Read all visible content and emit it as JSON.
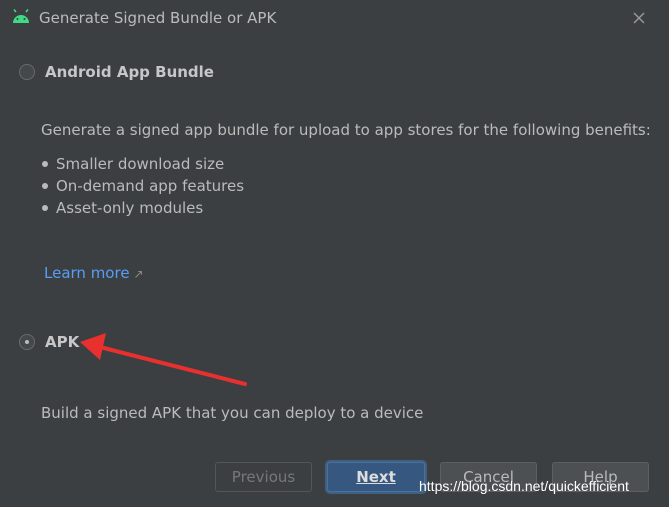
{
  "window": {
    "title": "Generate Signed Bundle or APK",
    "icon": "android-icon",
    "close_icon": "close-icon"
  },
  "options": {
    "bundle": {
      "label": "Android App Bundle",
      "selected": false,
      "description": "Generate a signed app bundle for upload to app stores for the following benefits:",
      "benefits": [
        "Smaller download size",
        "On-demand app features",
        "Asset-only modules"
      ],
      "learn_more": "Learn more",
      "learn_more_icon": "external-link-arrow-icon"
    },
    "apk": {
      "label": "APK",
      "selected": true,
      "description": "Build a signed APK that you can deploy to a device"
    }
  },
  "buttons": {
    "previous": "Previous",
    "next": "Next",
    "cancel": "Cancel",
    "help": "Help"
  },
  "watermark": "https://blog.csdn.net/quickefficient",
  "colors": {
    "background": "#3c3f41",
    "link": "#589df6",
    "primary_button": "#365880",
    "annotation_arrow": "#e8312f",
    "android_green": "#3ddc84"
  }
}
